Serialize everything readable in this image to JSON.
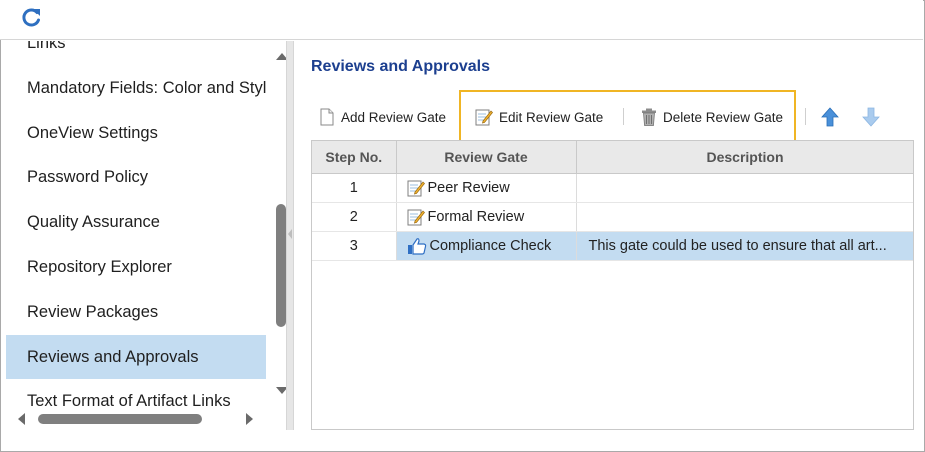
{
  "toolbar_top": {
    "refresh_icon": "refresh-icon"
  },
  "sidebar": {
    "items": [
      {
        "label": "Links",
        "selected": false
      },
      {
        "label": "Mandatory Fields: Color and Style",
        "selected": false
      },
      {
        "label": "OneView Settings",
        "selected": false
      },
      {
        "label": "Password Policy",
        "selected": false
      },
      {
        "label": "Quality Assurance",
        "selected": false
      },
      {
        "label": "Repository Explorer",
        "selected": false
      },
      {
        "label": "Review Packages",
        "selected": false
      },
      {
        "label": "Reviews and Approvals",
        "selected": true
      },
      {
        "label": "Text Format of Artifact Links",
        "selected": false
      }
    ]
  },
  "main": {
    "title": "Reviews and Approvals",
    "toolbar": {
      "add_label": "Add Review Gate",
      "edit_label": "Edit Review Gate",
      "delete_label": "Delete Review Gate",
      "move_up_icon": "arrow-up-icon",
      "move_down_icon": "arrow-down-icon"
    },
    "table": {
      "columns": [
        "Step No.",
        "Review Gate",
        "Description"
      ],
      "rows": [
        {
          "step": "1",
          "gate": "Peer Review",
          "icon": "edit-note-icon",
          "description": "",
          "selected": false
        },
        {
          "step": "2",
          "gate": "Formal Review",
          "icon": "edit-note-icon",
          "description": "",
          "selected": false
        },
        {
          "step": "3",
          "gate": "Compliance Check",
          "icon": "thumbs-up-icon",
          "description": "This gate could be used to ensure that all art...",
          "selected": true
        }
      ]
    }
  },
  "colors": {
    "accent_title": "#1c3f8f",
    "selection": "#c3dcf1",
    "highlight_box": "#f0b524",
    "refresh_icon": "#2e6fc0"
  }
}
